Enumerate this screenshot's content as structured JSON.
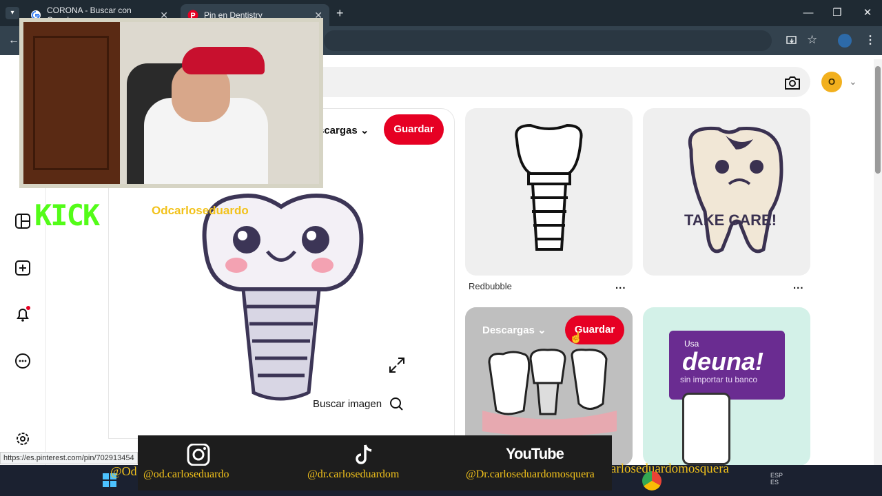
{
  "browser": {
    "tabs": [
      {
        "title": "CORONA - Buscar con Google",
        "favicon": "google-icon"
      },
      {
        "title": "Pin en Dentistry",
        "favicon": "pinterest-icon",
        "active": true
      }
    ],
    "new_tab": "+",
    "window_controls": {
      "minimize": "—",
      "restore": "❐",
      "close": "✕"
    },
    "status_url": "https://es.pinterest.com/pin/702913454"
  },
  "pinterest": {
    "avatar_initial": "O",
    "main_pin": {
      "downloads_label": "scargas",
      "save_label": "Guardar",
      "search_image_label": "Buscar imagen"
    },
    "grid": [
      {
        "source": "Redbubble",
        "more": "..."
      },
      {
        "text_in_image": "TAKE CARE!",
        "more": "..."
      },
      {
        "downloads_label": "Descargas",
        "save_label": "Guardar"
      },
      {
        "usa": "Usa",
        "title": "deuna!",
        "subtitle": "sin importar tu banco"
      }
    ]
  },
  "overlay": {
    "kick_logo": "KICK",
    "kick_user": "Odcarloseduardo",
    "instagram": "@od.carloseduardo",
    "tiktok": "@dr.carloseduardom",
    "youtube": "@Dr.carloseduardomosquera",
    "youtube_logo": "YouTube",
    "taskbar_left": "@Od",
    "taskbar_right": "arloseduardomosquera"
  },
  "taskbar": {
    "lang_line1": "ESP",
    "lang_line2": "ES"
  },
  "colors": {
    "pinterest_red": "#e60023",
    "chrome_dark": "#1f2a33",
    "kick_green": "#53fc18",
    "handle_yellow": "#f2c21b"
  }
}
